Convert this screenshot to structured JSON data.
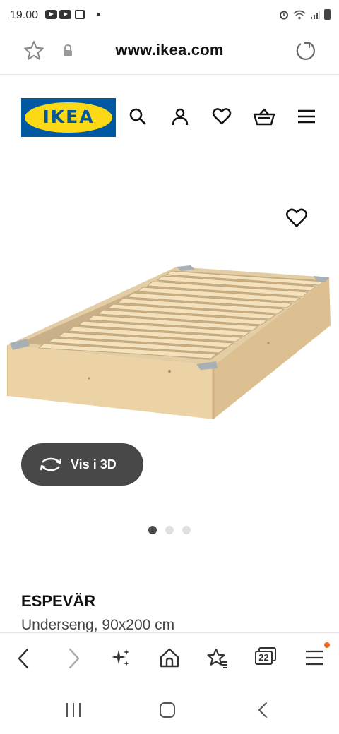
{
  "status_bar": {
    "time": "19.00"
  },
  "browser": {
    "url": "www.ikea.com"
  },
  "header": {
    "logo_text": "IKEA",
    "logo_colors": {
      "blue": "#0058a3",
      "yellow": "#fbd914"
    }
  },
  "product": {
    "view_3d_label": "Vis i 3D",
    "gallery": {
      "total_images": 3,
      "active_index": 0
    },
    "name": "ESPEVÄR",
    "description": "Underseng, 90x200 cm"
  },
  "toolbar": {
    "tabs_count": "22"
  },
  "icons": {
    "status": [
      "youtube-icon",
      "youtube-icon",
      "calendar-icon",
      "alarm-icon",
      "wifi-icon",
      "signal-icon",
      "battery-icon"
    ],
    "header": [
      "search-icon",
      "user-icon",
      "heart-icon",
      "cart-icon",
      "menu-icon"
    ],
    "toolbar": [
      "back-icon",
      "forward-icon",
      "sparkle-icon",
      "home-icon",
      "bookmarks-icon",
      "tabs-icon",
      "menu-icon"
    ]
  },
  "colors": {
    "button_dark": "#484848",
    "notification": "#f36b21"
  }
}
